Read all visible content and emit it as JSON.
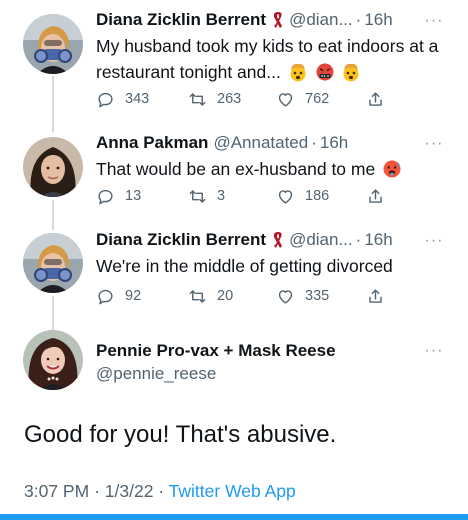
{
  "tweets": [
    {
      "name": "Diana Zicklin Berrent",
      "handle": "@dian...",
      "time": "16h",
      "text": "My husband took my kids to eat indoors at a restaurant tonight and...",
      "emojis": [
        "exploding-head",
        "cursing-face",
        "exploding-head"
      ],
      "replies": "343",
      "retweets": "263",
      "likes": "762"
    },
    {
      "name": "Anna Pakman",
      "handle": "@Annatated",
      "time": "16h",
      "text": "That would be an ex-husband to me",
      "emojis": [
        "hot-face"
      ],
      "replies": "13",
      "retweets": "3",
      "likes": "186"
    },
    {
      "name": "Diana Zicklin Berrent",
      "handle": "@dian...",
      "time": "16h",
      "text": "We're in the middle of getting divorced",
      "replies": "92",
      "retweets": "20",
      "likes": "335"
    }
  ],
  "main_tweet": {
    "name": "Pennie Pro-vax + Mask Reese",
    "handle": "@pennie_reese",
    "text": "Good for you! That's abusive.",
    "time": "3:07 PM",
    "date": "1/3/22",
    "app": "Twitter Web App"
  },
  "separator": "·",
  "more_glyph": "···",
  "colors": {
    "accent": "#1d9bf0",
    "muted": "#536471",
    "thread_line": "#cfd9de",
    "ribbon": "#b0172a"
  }
}
